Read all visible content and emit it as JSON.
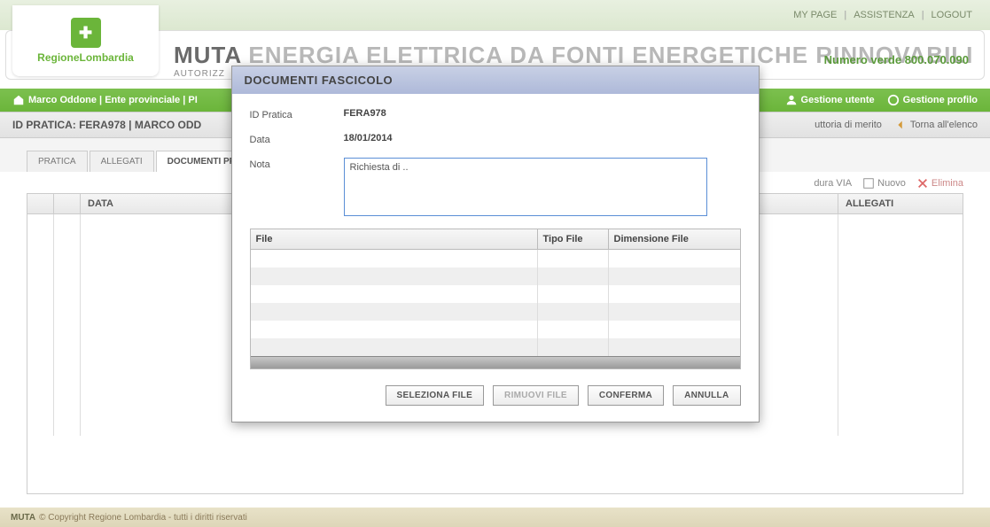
{
  "header": {
    "my_page": "MY PAGE",
    "assistenza": "ASSISTENZA",
    "logout": "LOGOUT"
  },
  "logo": {
    "region": "RegioneLombardia"
  },
  "title": {
    "muta": "MUTA",
    "rest": " ENERGIA ELETTRICA DA FONTI ENERGETICHE RINNOVABILI",
    "sub": "AUTORIZZ",
    "numero_label": "Numero verde 800.070.090"
  },
  "breadcrumb": {
    "left": "Marco Oddone | Ente provinciale | PI",
    "gestione_utente": "Gestione utente",
    "gestione_profilo": "Gestione profilo"
  },
  "context": {
    "left": "ID PRATICA: FERA978 | MARCO ODD",
    "istruttoria": "uttoria di merito",
    "torna": "Torna all'elenco"
  },
  "tabs": {
    "pratica": "PRATICA",
    "allegati": "ALLEGATI",
    "documenti": "DOCUMENTI PROC"
  },
  "table_actions": {
    "via": "dura VIA",
    "nuovo": "Nuovo",
    "elimina": "Elimina"
  },
  "table": {
    "data": "DATA",
    "allegati": "ALLEGATI"
  },
  "modal": {
    "title": "DOCUMENTI FASCICOLO",
    "id_pratica_label": "ID Pratica",
    "id_pratica_value": "FERA978",
    "data_label": "Data",
    "data_value": "18/01/2014",
    "nota_label": "Nota",
    "nota_value": "Richiesta di ..",
    "file_table": {
      "file": "File",
      "tipo": "Tipo File",
      "dim": "Dimensione File"
    },
    "buttons": {
      "seleziona": "SELEZIONA FILE",
      "rimuovi": "RIMUOVI FILE",
      "conferma": "CONFERMA",
      "annulla": "ANNULLA"
    }
  },
  "footer": {
    "muta": "MUTA",
    "text": " © Copyright Regione Lombardia - tutti i diritti riservati"
  }
}
